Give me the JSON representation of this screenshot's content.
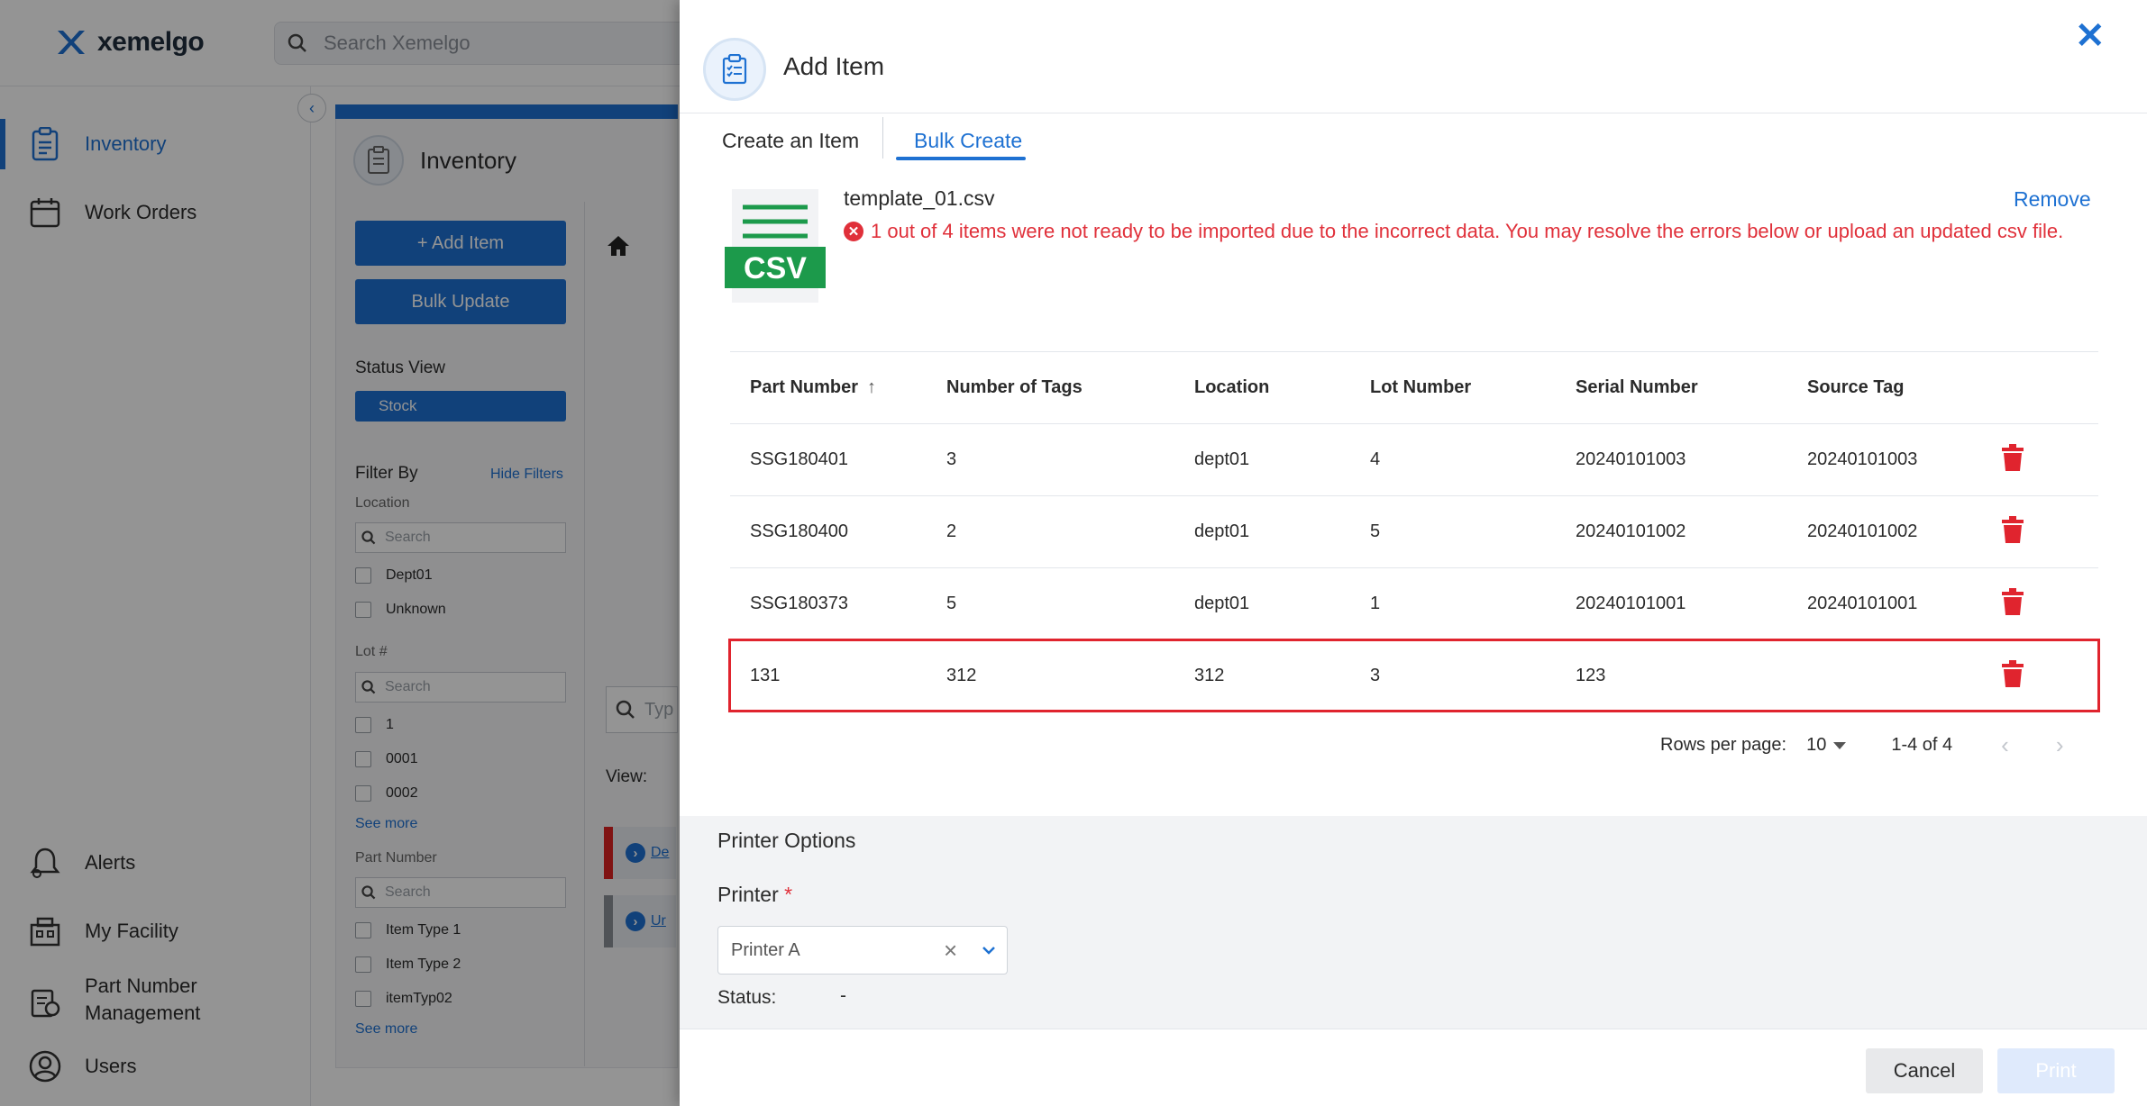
{
  "app": {
    "brand": "xemelgo",
    "search_placeholder": "Search Xemelgo"
  },
  "sidebar": {
    "items": [
      {
        "label": "Inventory",
        "icon": "clipboard-icon",
        "active": true
      },
      {
        "label": "Work Orders",
        "icon": "calendar-icon"
      },
      {
        "label": "Alerts",
        "icon": "bell-icon"
      },
      {
        "label": "My Facility",
        "icon": "building-icon"
      },
      {
        "label": "Part Number Management",
        "icon": "parts-icon"
      },
      {
        "label": "Users",
        "icon": "user-icon"
      }
    ]
  },
  "background": {
    "page_title": "Inventory",
    "add_item_label": "+ Add Item",
    "bulk_update_label": "Bulk Update",
    "status_view_label": "Status View",
    "status_view_value": "Stock",
    "filter_by_label": "Filter By",
    "hide_filters_label": "Hide Filters",
    "location_label": "Location",
    "lot_label": "Lot #",
    "part_number_label": "Part Number",
    "search_placeholder": "Search",
    "location_options": [
      "Dept01",
      "Unknown"
    ],
    "lot_options": [
      "1",
      "0001",
      "0002"
    ],
    "part_options": [
      "Item Type 1",
      "Item Type 2",
      "itemTyp02"
    ],
    "see_more_label": "See more",
    "view_label": "View:",
    "type_placeholder": "Typ",
    "list_items": [
      "De",
      "Ur"
    ]
  },
  "modal": {
    "title": "Add Item",
    "tabs": [
      "Create an Item",
      "Bulk Create"
    ],
    "active_tab": "Bulk Create",
    "file": {
      "name": "template_01.csv",
      "icon_text": "CSV",
      "remove_label": "Remove",
      "error_message": "1 out of 4 items were not ready to be imported due to the incorrect data. You may resolve the errors below or upload an updated csv file."
    },
    "table": {
      "headers": [
        "Part Number",
        "Number of Tags",
        "Location",
        "Lot Number",
        "Serial Number",
        "Source Tag"
      ],
      "rows": [
        [
          "SSG180401",
          "3",
          "dept01",
          "4",
          "20240101003",
          "20240101003"
        ],
        [
          "SSG180400",
          "2",
          "dept01",
          "5",
          "20240101002",
          "20240101002"
        ],
        [
          "SSG180373",
          "5",
          "dept01",
          "1",
          "20240101001",
          "20240101001"
        ],
        [
          "131",
          "312",
          "312",
          "3",
          "123",
          ""
        ]
      ],
      "error_row_index": 3
    },
    "pagination": {
      "rows_per_page_label": "Rows per page:",
      "rows_per_page": "10",
      "range": "1-4 of 4"
    },
    "printer": {
      "section_title": "Printer Options",
      "label": "Printer",
      "required_mark": "*",
      "selected": "Printer A",
      "status_label": "Status:",
      "status_value": "-"
    },
    "footer": {
      "cancel_label": "Cancel",
      "print_label": "Print"
    },
    "colors": {
      "accent": "#1e71d2",
      "error": "#e0303a",
      "csv_green": "#1c9a4b"
    }
  }
}
